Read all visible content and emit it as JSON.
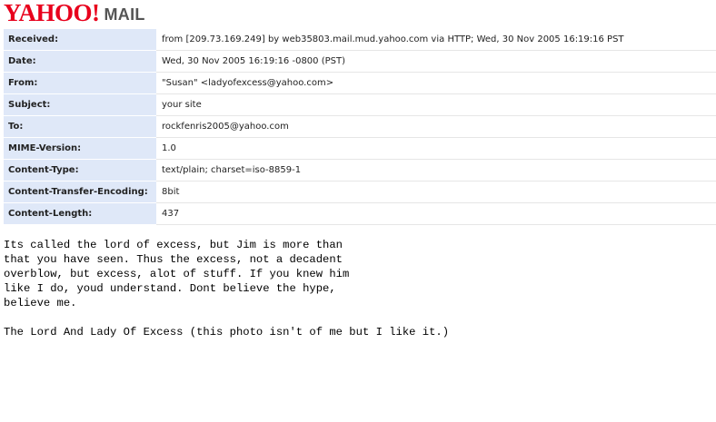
{
  "header": {
    "logo_yahoo": "YAHOO!",
    "logo_mail": "MAIL"
  },
  "headers": [
    {
      "name": "Received:",
      "value": "from [209.73.169.249] by web35803.mail.mud.yahoo.com via HTTP; Wed, 30 Nov 2005 16:19:16 PST"
    },
    {
      "name": "Date:",
      "value": "Wed, 30 Nov 2005 16:19:16 -0800 (PST)"
    },
    {
      "name": "From:",
      "value": "\"Susan\" <ladyofexcess@yahoo.com>"
    },
    {
      "name": "Subject:",
      "value": "your site"
    },
    {
      "name": "To:",
      "value": "rockfenris2005@yahoo.com"
    },
    {
      "name": "MIME-Version:",
      "value": "1.0"
    },
    {
      "name": "Content-Type:",
      "value": "text/plain; charset=iso-8859-1"
    },
    {
      "name": "Content-Transfer-Encoding:",
      "value": "8bit"
    },
    {
      "name": "Content-Length:",
      "value": "437"
    }
  ],
  "message": {
    "body": "Its called the lord of excess, but Jim is more than\nthat you have seen. Thus the excess, not a decadent\noverblow, but excess, alot of stuff. If you knew him\nlike I do, youd understand. Dont believe the hype,\nbelieve me.\n\nThe Lord And Lady Of Excess (this photo isn't of me but I like it.)"
  }
}
